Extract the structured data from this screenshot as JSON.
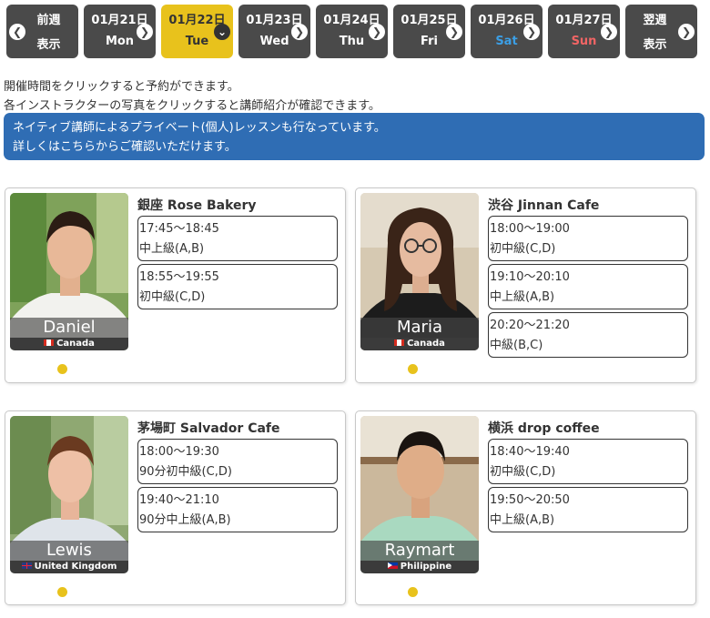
{
  "datebar": {
    "prev": {
      "line1": "前週",
      "line2": "表示"
    },
    "next": {
      "line1": "翌週",
      "line2": "表示"
    },
    "days": [
      {
        "date": "01月21日",
        "dow": "Mon"
      },
      {
        "date": "01月22日",
        "dow": "Tue"
      },
      {
        "date": "01月23日",
        "dow": "Wed"
      },
      {
        "date": "01月24日",
        "dow": "Thu"
      },
      {
        "date": "01月25日",
        "dow": "Fri"
      },
      {
        "date": "01月26日",
        "dow": "Sat"
      },
      {
        "date": "01月27日",
        "dow": "Sun"
      }
    ],
    "selected_index": 1,
    "colors": {
      "button": "#4a4a4a",
      "selected": "#e8c21c",
      "sat": "#3b9fe6",
      "sun": "#f16565"
    }
  },
  "info": {
    "line1": "開催時間をクリックすると予約ができます。",
    "line2": "各インストラクターの写真をクリックすると講師紹介が確認できます。"
  },
  "banner": {
    "line1": "ネイティブ講師によるプライベート(個人)レッスンも行なっています。",
    "line2": "詳しくはこちらからご確認いただけます。",
    "color": "#2f6db4"
  },
  "lessons": [
    {
      "instructor": "Daniel",
      "country": "Canada",
      "venue": "銀座 Rose Bakery",
      "slots": [
        {
          "time": "17:45～18:45",
          "level": "中上級(A,B)"
        },
        {
          "time": "18:55～19:55",
          "level": "初中級(C,D)"
        }
      ]
    },
    {
      "instructor": "Maria",
      "country": "Canada",
      "venue": "渋谷 Jinnan Cafe",
      "slots": [
        {
          "time": "18:00～19:00",
          "level": "初中級(C,D)"
        },
        {
          "time": "19:10～20:10",
          "level": "中上級(A,B)"
        },
        {
          "time": "20:20～21:20",
          "level": "中級(B,C)"
        }
      ]
    },
    {
      "instructor": "Lewis",
      "country": "United Kingdom",
      "venue": "茅場町 Salvador Cafe",
      "slots": [
        {
          "time": "18:00～19:30",
          "level": "90分初中級(C,D)"
        },
        {
          "time": "19:40～21:10",
          "level": "90分中上級(A,B)"
        }
      ]
    },
    {
      "instructor": "Raymart",
      "country": "Philippine",
      "venue": "横浜 drop coffee",
      "slots": [
        {
          "time": "18:40～19:40",
          "level": "初中級(C,D)"
        },
        {
          "time": "19:50～20:50",
          "level": "中上級(A,B)"
        }
      ]
    }
  ]
}
